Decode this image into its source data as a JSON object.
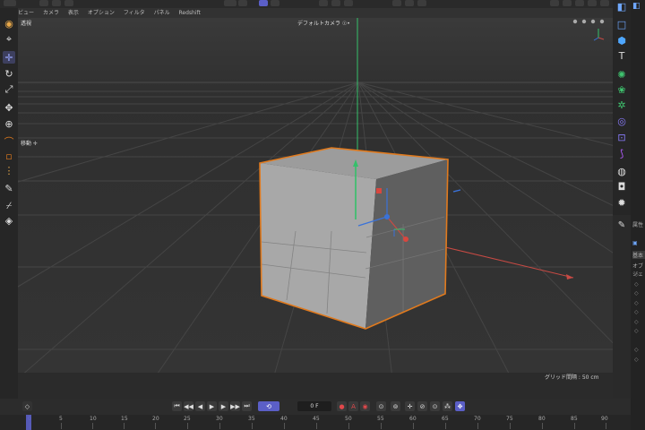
{
  "menu": {
    "items": [
      "ビュー",
      "カメラ",
      "表示",
      "オプション",
      "フィルタ",
      "パネル",
      "Redshift"
    ]
  },
  "viewport": {
    "view_name": "透視",
    "camera_label": "デフォルトカメラ ☉•",
    "move_label": "移動 ✛",
    "grid_label": "グリッド間隔 : 50 cm"
  },
  "transport": {
    "frame_value": "0 F"
  },
  "timeline": {
    "ticks": [
      "0",
      "5",
      "10",
      "15",
      "20",
      "25",
      "30",
      "35",
      "40",
      "45",
      "50",
      "55",
      "60",
      "65",
      "70",
      "75",
      "80",
      "85",
      "90"
    ]
  },
  "side_panel": {
    "title": "属性",
    "tab": "基本",
    "section": "オブジェ"
  },
  "colors": {
    "accent": "#5b5fc7",
    "selection_outline": "#e07a1e",
    "axis_x": "#d9473f",
    "axis_y": "#35c06a",
    "axis_z": "#3a72d9"
  }
}
